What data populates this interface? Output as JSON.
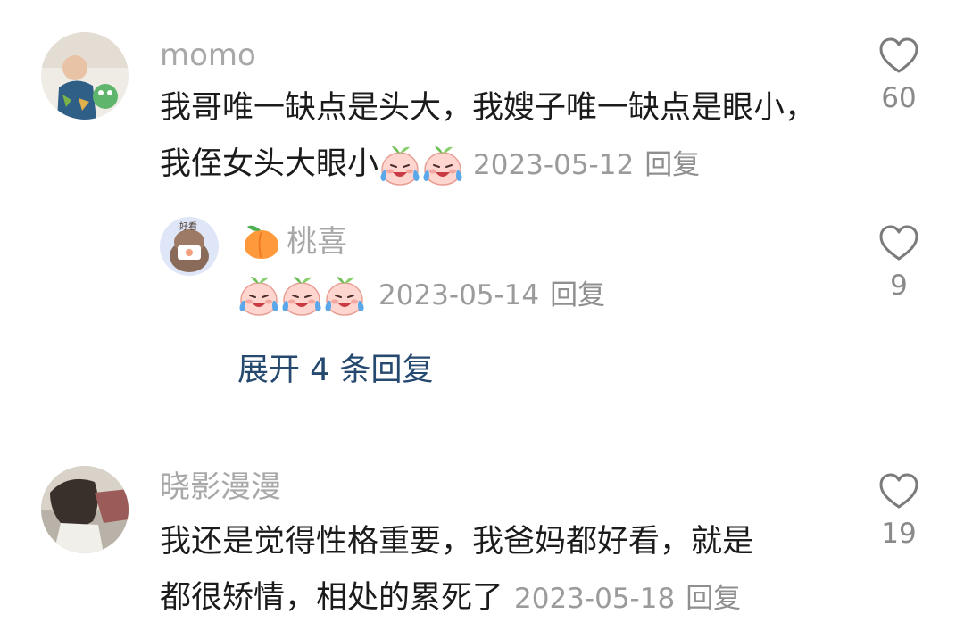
{
  "comments": [
    {
      "username": "momo",
      "text": "我哥唯一缺点是头大，我嫂子唯一缺点是眼小，我侄女头大眼小",
      "emoji_icon": "crying-laughing-peach-emoji",
      "emoji_count": 2,
      "date": "2023-05-12",
      "reply_label": "回复",
      "likes": "60",
      "replies": [
        {
          "username_emoji": "peach-icon",
          "username": "桃喜",
          "emoji_icon": "crying-laughing-peach-emoji",
          "emoji_count": 3,
          "date": "2023-05-14",
          "reply_label": "回复",
          "likes": "9"
        }
      ],
      "expand_label": "展开 4 条回复"
    },
    {
      "username": "晓影漫漫",
      "text_line1": "我还是觉得性格重要，我爸妈都好看，就是",
      "text_line2": "都很矫情，相处的累死了",
      "date": "2023-05-18",
      "reply_label": "回复",
      "likes": "19"
    }
  ],
  "colors": {
    "username": "#a8a8a8",
    "text": "#1b1b1b",
    "meta": "#9b9b9b",
    "expand_link": "#25496f",
    "divider": "#e7e7e7"
  }
}
